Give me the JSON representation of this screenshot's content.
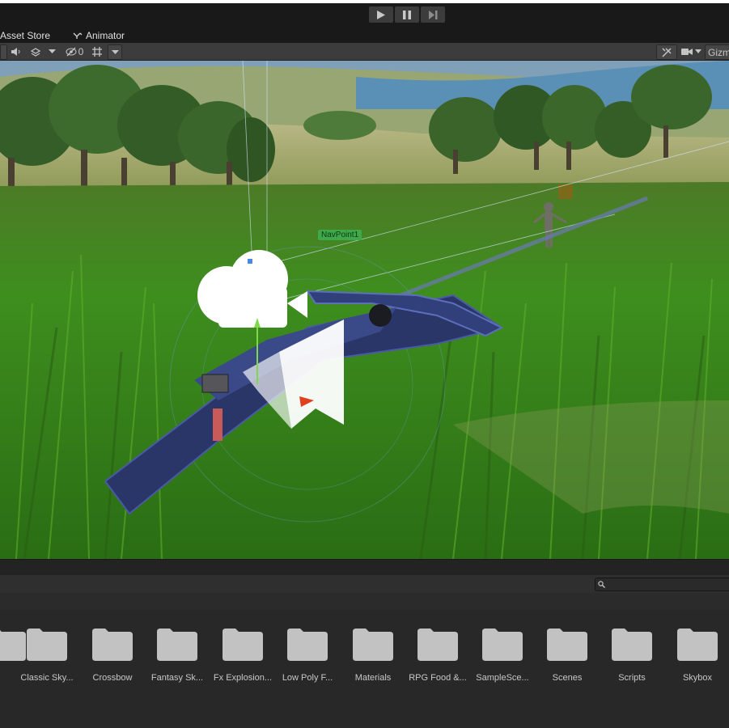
{
  "toolbar": {
    "play_icon": "play-icon",
    "pause_icon": "pause-icon",
    "step_icon": "step-icon"
  },
  "tabs": {
    "asset_store": "Asset Store",
    "animator": "Animator"
  },
  "scene_toolbar": {
    "hidden_count": "0",
    "gizmos_label": "Gizm"
  },
  "scene": {
    "nav_point_label": "NavPoint1"
  },
  "project": {
    "search_placeholder": "",
    "folders": [
      {
        "label": "Classic Sky..."
      },
      {
        "label": "Crossbow"
      },
      {
        "label": "Fantasy Sk..."
      },
      {
        "label": "Fx Explosion..."
      },
      {
        "label": "Low Poly F..."
      },
      {
        "label": "Materials"
      },
      {
        "label": "RPG Food &..."
      },
      {
        "label": "SampleSce..."
      },
      {
        "label": "Scenes"
      },
      {
        "label": "Scripts"
      },
      {
        "label": "Skybox"
      }
    ]
  }
}
